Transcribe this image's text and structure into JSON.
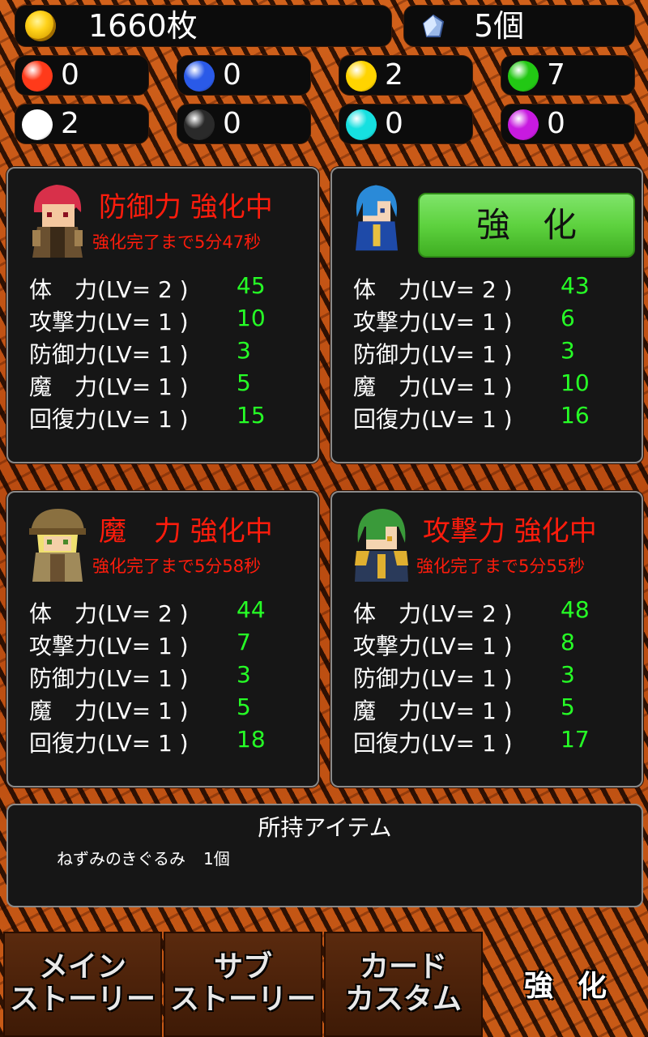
{
  "currency": {
    "coins": "1660枚",
    "gems": "5個"
  },
  "orbs": [
    {
      "name": "red-orb",
      "count": "0",
      "color": "#ff3a1a"
    },
    {
      "name": "blue-orb",
      "count": "0",
      "color": "#2a5ae8"
    },
    {
      "name": "yellow-orb",
      "count": "2",
      "color": "#ffd400"
    },
    {
      "name": "green-orb",
      "count": "7",
      "color": "#22c814"
    },
    {
      "name": "white-orb",
      "count": "2",
      "color": "#ffffff"
    },
    {
      "name": "black-orb",
      "count": "0",
      "color": "#2a2a2a"
    },
    {
      "name": "cyan-orb",
      "count": "0",
      "color": "#16e0e0"
    },
    {
      "name": "purple-orb",
      "count": "0",
      "color": "#c81ae0"
    }
  ],
  "characters": [
    {
      "status_title": "防御力 強化中",
      "status_sub": "強化完了まで5分47秒",
      "stats": [
        {
          "label": "体　力(LV= 2 )",
          "value": "45"
        },
        {
          "label": "攻撃力(LV= 1 )",
          "value": "10"
        },
        {
          "label": "防御力(LV= 1 )",
          "value": "3"
        },
        {
          "label": "魔　力(LV= 1 )",
          "value": "5"
        },
        {
          "label": "回復力(LV= 1 )",
          "value": "15"
        }
      ]
    },
    {
      "button_label": "強化",
      "stats": [
        {
          "label": "体　力(LV= 2 )",
          "value": "43"
        },
        {
          "label": "攻撃力(LV= 1 )",
          "value": "6"
        },
        {
          "label": "防御力(LV= 1 )",
          "value": "3"
        },
        {
          "label": "魔　力(LV= 1 )",
          "value": "10"
        },
        {
          "label": "回復力(LV= 1 )",
          "value": "16"
        }
      ]
    },
    {
      "status_title": "魔　力 強化中",
      "status_sub": "強化完了まで5分58秒",
      "stats": [
        {
          "label": "体　力(LV= 2 )",
          "value": "44"
        },
        {
          "label": "攻撃力(LV= 1 )",
          "value": "7"
        },
        {
          "label": "防御力(LV= 1 )",
          "value": "3"
        },
        {
          "label": "魔　力(LV= 1 )",
          "value": "5"
        },
        {
          "label": "回復力(LV= 1 )",
          "value": "18"
        }
      ]
    },
    {
      "status_title": "攻撃力 強化中",
      "status_sub": "強化完了まで5分55秒",
      "stats": [
        {
          "label": "体　力(LV= 2 )",
          "value": "48"
        },
        {
          "label": "攻撃力(LV= 1 )",
          "value": "8"
        },
        {
          "label": "防御力(LV= 1 )",
          "value": "3"
        },
        {
          "label": "魔　力(LV= 1 )",
          "value": "5"
        },
        {
          "label": "回復力(LV= 1 )",
          "value": "17"
        }
      ]
    }
  ],
  "items": {
    "title": "所持アイテム",
    "list": [
      {
        "name": "ねずみのきぐるみ",
        "count": "1個"
      }
    ]
  },
  "tabs": [
    {
      "line1": "メイン",
      "line2": "ストーリー"
    },
    {
      "line1": "サブ",
      "line2": "ストーリー"
    },
    {
      "line1": "カード",
      "line2": "カスタム"
    },
    {
      "line1": "強化",
      "line2": ""
    }
  ],
  "colors": {
    "status_red": "#ff1c0c",
    "stat_green": "#26ff26",
    "button_green": "#5ed23f"
  }
}
